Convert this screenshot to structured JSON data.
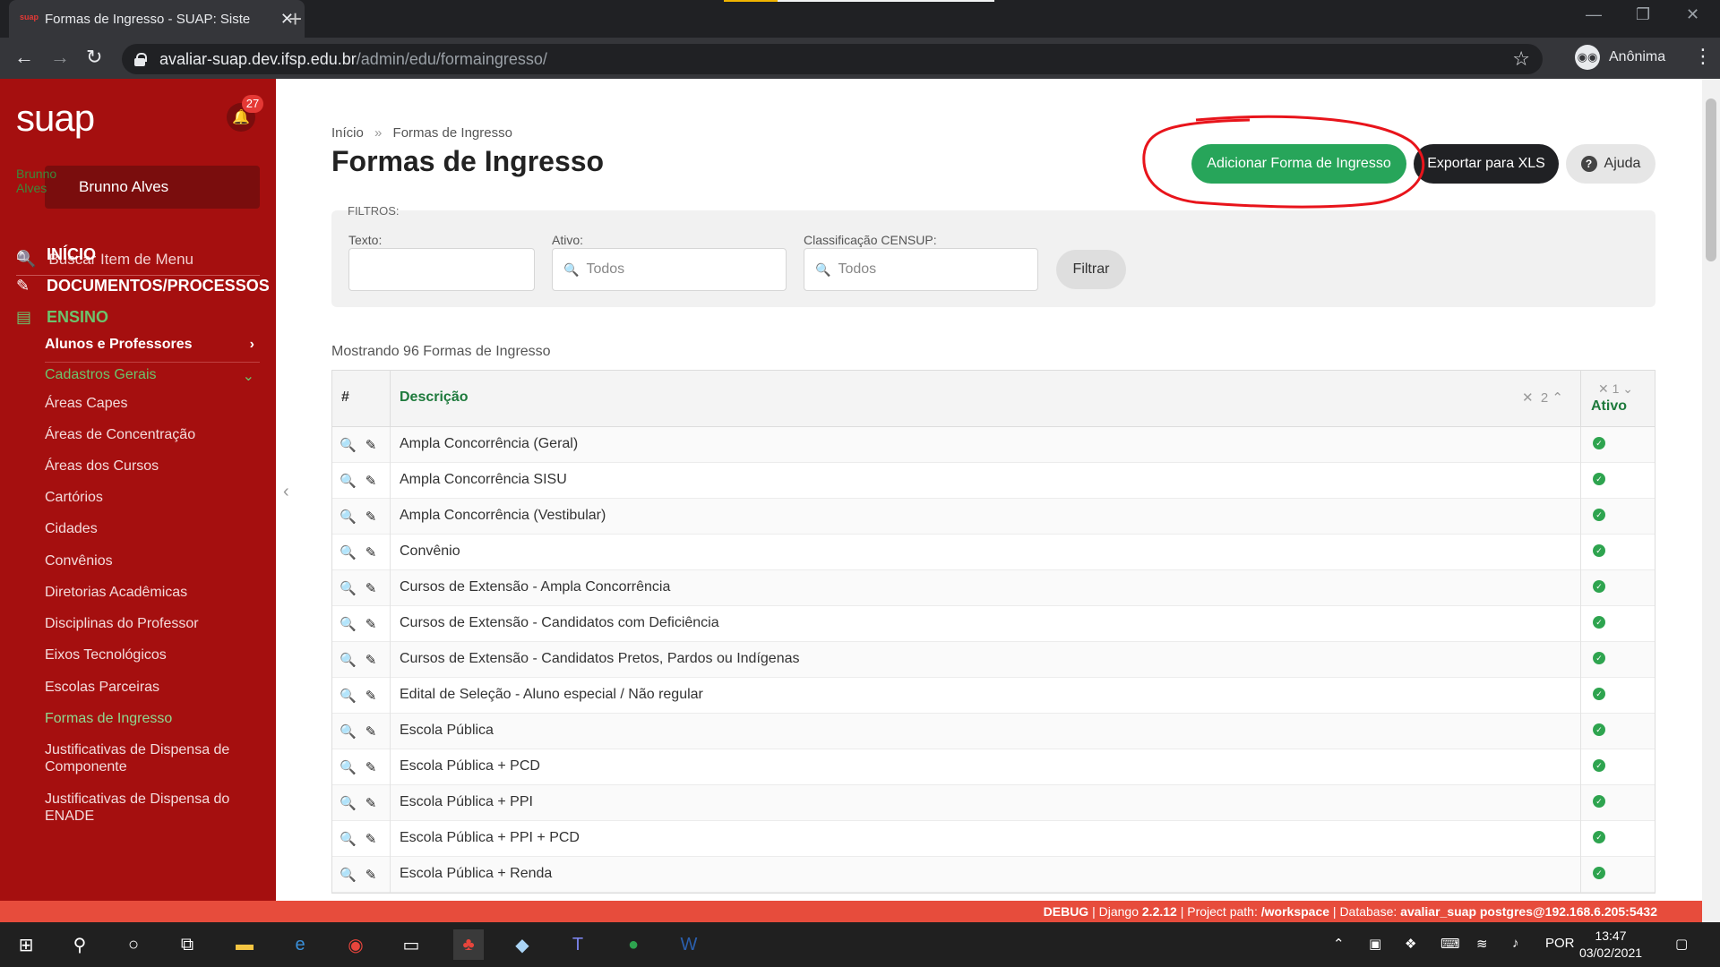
{
  "browser": {
    "tab_title": "Formas de Ingresso - SUAP: Siste",
    "url_host": "avaliar-suap.dev.ifsp.edu.br",
    "url_path": "/admin/edu/formaingresso/",
    "profile_label": "Anônima"
  },
  "sidebar": {
    "logo": "suap",
    "notification_count": "27",
    "user_name": "Brunno Alves",
    "avatar_alt": "Brunno Alves",
    "search_placeholder": "Buscar Item de Menu",
    "sections": [
      {
        "label": "INÍCIO",
        "icon": "home-icon"
      },
      {
        "label": "DOCUMENTOS/PROCESSOS",
        "icon": "edit-icon"
      },
      {
        "label": "ENSINO",
        "icon": "teach-icon"
      }
    ],
    "sub_alunos": "Alunos e Professores",
    "sub_cadastros": "Cadastros Gerais",
    "items": [
      "Áreas Capes",
      "Áreas de Concentração",
      "Áreas dos Cursos",
      "Cartórios",
      "Cidades",
      "Convênios",
      "Diretorias Acadêmicas",
      "Disciplinas do Professor",
      "Eixos Tecnológicos",
      "Escolas Parceiras",
      "Formas de Ingresso",
      "Justificativas de Dispensa de Componente",
      "Justificativas de Dispensa do ENADE"
    ],
    "current_item_index": 10
  },
  "main": {
    "breadcrumb_home": "Início",
    "breadcrumb_sep": "»",
    "breadcrumb_current": "Formas de Ingresso",
    "title": "Formas de Ingresso",
    "add_button": "Adicionar Forma de Ingresso",
    "export_button": "Exportar para XLS",
    "help_button": "Ajuda",
    "filters": {
      "heading": "FILTROS:",
      "text_label": "Texto:",
      "text_value": "",
      "ativo_label": "Ativo:",
      "ativo_value": "Todos",
      "censup_label": "Classificação CENSUP:",
      "censup_value": "Todos",
      "submit": "Filtrar"
    },
    "count_text": "Mostrando 96 Formas de Ingresso",
    "table": {
      "col_hash": "#",
      "col_desc": "Descrição",
      "col_desc_sort": "2",
      "col_ativo": "Ativo",
      "col_ativo_sort": "1",
      "rows": [
        "Ampla Concorrência (Geral)",
        "Ampla Concorrência SISU",
        "Ampla Concorrência (Vestibular)",
        "Convênio",
        "Cursos de Extensão - Ampla Concorrência",
        "Cursos de Extensão - Candidatos com Deficiência",
        "Cursos de Extensão - Candidatos Pretos, Pardos ou Indígenas",
        "Edital de Seleção - Aluno especial / Não regular",
        "Escola Pública",
        "Escola Pública + PCD",
        "Escola Pública + PPI",
        "Escola Pública + PPI + PCD",
        "Escola Pública + Renda"
      ]
    }
  },
  "debug_bar": {
    "debug": "DEBUG",
    "django": "Django",
    "django_version": "2.2.12",
    "project_label": "Project path:",
    "project_path": "/workspace",
    "db_label": "Database:",
    "db_value": "avaliar_suap postgres@192.168.6.205:5432"
  },
  "taskbar": {
    "language": "POR",
    "time": "13:47",
    "date": "03/02/2021"
  },
  "colors": {
    "sidebar_bg": "#a50f0f",
    "accent_green": "#27a55a",
    "debug_bar": "#e74c3c"
  }
}
